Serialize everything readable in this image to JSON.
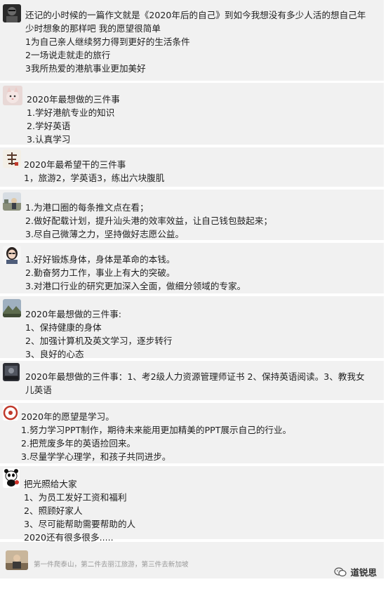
{
  "comments": [
    {
      "avatar_icon": "dark-portrait-avatar-icon",
      "lines": [
        "还记的小时候的一篇作文就是《2020年后的自己》到如今我想没有多少人活的想自己年",
        "少时想象的那样吧  我的愿望很简单",
        "1为自己亲人继续努力得到更好的生活条件",
        "2一场说走就走的旅行",
        "3我所热爱的港航事业更加美好"
      ]
    },
    {
      "avatar_icon": "pink-cat-avatar-icon",
      "lines": [
        "2020年最想做的三件事",
        "1.学好港航专业的知识",
        "2.学好英语",
        "3.认真学习"
      ]
    },
    {
      "avatar_icon": "calligraphy-avatar-icon",
      "lines": [
        "2020年最希望干的三件事",
        "1，旅游2，学英语3，练出六块腹肌"
      ]
    },
    {
      "avatar_icon": "landscape-avatar-icon",
      "lines": [
        "1.为港口圈的每条推文点在看；",
        "2.做好配载计划，提升汕头港的效率效益，让自己钱包鼓起来；",
        "3.尽自己微薄之力，坚持做好志愿公益。"
      ]
    },
    {
      "avatar_icon": "woman-portrait-avatar-icon",
      "lines": [
        "1.好好锻炼身体，身体是革命的本钱。",
        "2.勤奋努力工作，事业上有大的突破。",
        "3.对港口行业的研究更加深入全面，做细分领域的专家。"
      ]
    },
    {
      "avatar_icon": "mountain-avatar-icon",
      "lines": [
        "2020年最想做的三件事:",
        "1、保持健康的身体",
        "2、加强计算机及英文学习，逐步转行",
        "3、良好的心态"
      ]
    },
    {
      "avatar_icon": "dark-photo-avatar-icon",
      "lines": [
        "2020年最想做的三件事：1、考2级人力资源管理师证书 2、保持英语阅读。3、教我女",
        "儿英语"
      ]
    },
    {
      "avatar_icon": "red-circle-avatar-icon",
      "lines": [
        "2020年的愿望是学习。",
        "1.努力学习PPT制作，期待未来能用更加精美的PPT展示自己的行业。",
        "2.把荒废多年的英语捡回来。",
        "3.尽量学学心理学，和孩子共同进步。"
      ]
    },
    {
      "avatar_icon": "panda-avatar-icon",
      "lines": [
        "把光照给大家",
        "1、为员工发好工资和福利",
        "2、照顾好家人",
        "3、尽可能帮助需要帮助的人",
        "2020还有很多很多....."
      ]
    },
    {
      "avatar_icon": "portrait-photo-avatar-icon",
      "lines": [
        "第一件爬泰山，第二件去丽江旅游，第三件去新加坡"
      ]
    }
  ],
  "watermark": {
    "icon": "wechat-bubble-icon",
    "text": "道锐思"
  }
}
